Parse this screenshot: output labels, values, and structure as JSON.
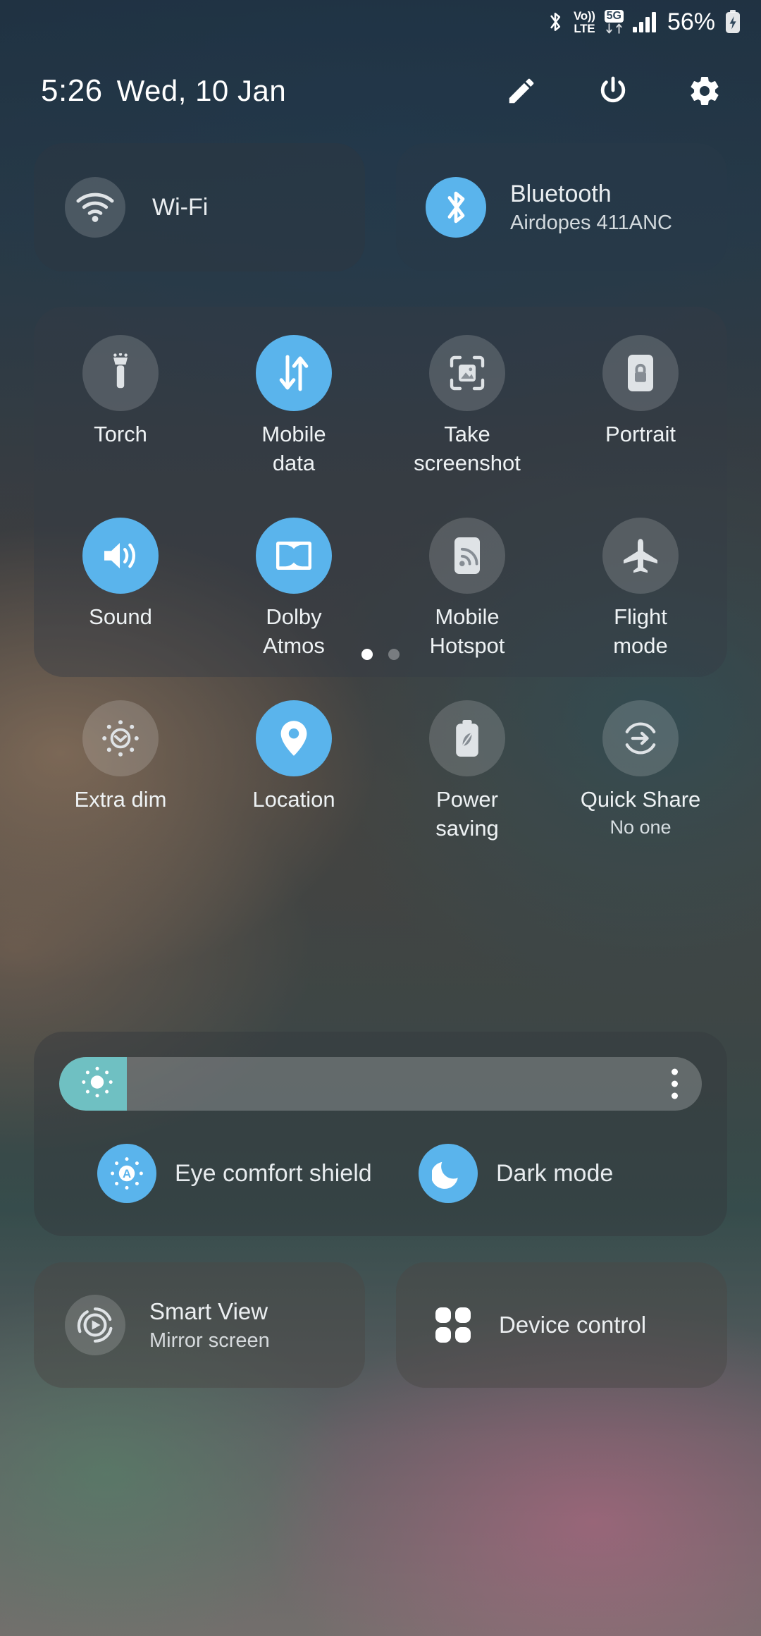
{
  "status_bar": {
    "icons": [
      "bluetooth-icon",
      "volte-icon",
      "5g-icon",
      "signal-bars-icon"
    ],
    "volte_line1": "Vo))",
    "volte_line2": "LTE",
    "network_badge": "5G",
    "battery_percent": "56%",
    "battery_state": "charging"
  },
  "header": {
    "time": "5:26",
    "date": "Wed, 10 Jan",
    "actions": [
      {
        "name": "edit-button",
        "icon": "pencil-icon"
      },
      {
        "name": "power-button",
        "icon": "power-icon"
      },
      {
        "name": "settings-button",
        "icon": "gear-icon"
      }
    ]
  },
  "connectivity": {
    "wifi": {
      "label": "Wi-Fi",
      "sub": "",
      "active": false,
      "icon": "wifi-icon"
    },
    "bluetooth": {
      "label": "Bluetooth",
      "sub": "Airdopes 411ANC",
      "active": true,
      "icon": "bluetooth-icon"
    }
  },
  "quick_toggles": {
    "rows": [
      [
        {
          "label_1": "Torch",
          "label_2": "",
          "sub": "",
          "active": false,
          "icon": "flashlight-icon"
        },
        {
          "label_1": "Mobile",
          "label_2": "data",
          "sub": "",
          "active": true,
          "icon": "mobile-data-icon"
        },
        {
          "label_1": "Take",
          "label_2": "screenshot",
          "sub": "",
          "active": false,
          "icon": "screenshot-icon"
        },
        {
          "label_1": "Portrait",
          "label_2": "",
          "sub": "",
          "active": false,
          "icon": "rotation-lock-icon"
        }
      ],
      [
        {
          "label_1": "Sound",
          "label_2": "",
          "sub": "",
          "active": true,
          "icon": "volume-icon"
        },
        {
          "label_1": "Dolby",
          "label_2": "Atmos",
          "sub": "",
          "active": true,
          "icon": "dolby-icon"
        },
        {
          "label_1": "Mobile",
          "label_2": "Hotspot",
          "sub": "",
          "active": false,
          "icon": "hotspot-icon"
        },
        {
          "label_1": "Flight",
          "label_2": "mode",
          "sub": "",
          "active": false,
          "icon": "airplane-icon"
        }
      ],
      [
        {
          "label_1": "Extra dim",
          "label_2": "",
          "sub": "",
          "active": false,
          "icon": "extra-dim-icon"
        },
        {
          "label_1": "Location",
          "label_2": "",
          "sub": "",
          "active": true,
          "icon": "location-pin-icon"
        },
        {
          "label_1": "Power",
          "label_2": "saving",
          "sub": "",
          "active": false,
          "icon": "power-saving-icon"
        },
        {
          "label_1": "Quick Share",
          "label_2": "",
          "sub": "No one",
          "active": false,
          "icon": "quick-share-icon"
        }
      ]
    ],
    "page_dots": {
      "count": 2,
      "active_index": 0
    }
  },
  "brightness": {
    "value_percent": 10.5,
    "icon": "brightness-sun-icon",
    "menu_icon": "overflow-menu-icon",
    "modes": [
      {
        "label": "Eye comfort shield",
        "active": true,
        "icon": "eye-comfort-icon"
      },
      {
        "label": "Dark mode",
        "active": true,
        "icon": "moon-icon"
      }
    ]
  },
  "bottom_tiles": [
    {
      "label": "Smart View",
      "sub": "Mirror screen",
      "icon": "smart-view-icon",
      "active": false
    },
    {
      "label": "Device control",
      "sub": "",
      "icon": "device-control-icon",
      "active": false
    }
  ],
  "colors": {
    "accent_blue": "#5ab4ec",
    "slider_fill": "#6fc0c2",
    "text_primary": "#ffffff"
  }
}
